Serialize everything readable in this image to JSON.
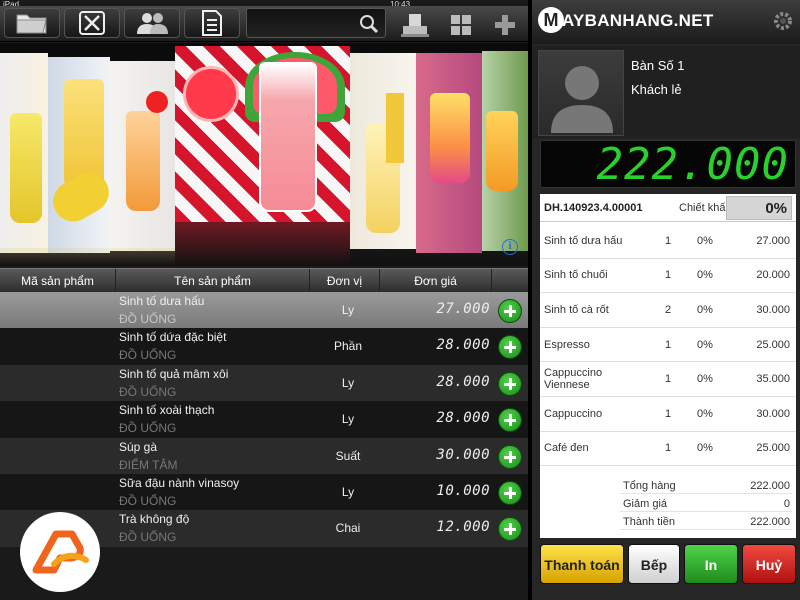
{
  "status": {
    "carrier": "iPad",
    "time": "10:43"
  },
  "toolbar": {
    "search_placeholder": "",
    "icons": [
      "folder-icon",
      "dining-icon",
      "users-icon",
      "document-icon",
      "search-icon",
      "printer-icon",
      "grid-icon",
      "plus-icon"
    ]
  },
  "table": {
    "headers": [
      "Mã sản phẩm",
      "Tên sản phẩm",
      "Đơn vị",
      "Đơn giá"
    ],
    "rows": [
      {
        "name": "Sinh tố dưa hấu",
        "category": "ĐỒ UỐNG",
        "unit": "Ly",
        "price": "27.000",
        "selected": true
      },
      {
        "name": "Sinh tố dứa đặc biệt",
        "category": "ĐỒ UỐNG",
        "unit": "Phần",
        "price": "28.000"
      },
      {
        "name": "Sinh tố quả mâm xôi",
        "category": "ĐỒ UỐNG",
        "unit": "Ly",
        "price": "28.000"
      },
      {
        "name": "Sinh tố xoài thạch",
        "category": "ĐỒ UỐNG",
        "unit": "Ly",
        "price": "28.000"
      },
      {
        "name": "Súp gà",
        "category": "ĐIỂM TÂM",
        "unit": "Suất",
        "price": "30.000"
      },
      {
        "name": "Sữa đậu nành vinasoy",
        "category": "ĐỒ UỐNG",
        "unit": "Ly",
        "price": "10.000"
      },
      {
        "name": "Trà không độ",
        "category": "ĐỒ UỐNG",
        "unit": "Chai",
        "price": "12.000"
      }
    ]
  },
  "brand": {
    "name": "AYBANHANG.NET",
    "initial": "M"
  },
  "customer": {
    "table": "Bàn Số 1",
    "name": "Khách lẻ"
  },
  "total_display": "222.000",
  "order": {
    "code": "DH.140923.4.00001",
    "discount_label": "Chiết khấu",
    "discount_value": "0%",
    "items": [
      {
        "name": "Sinh tố dưa hấu",
        "qty": "1",
        "disc": "0%",
        "price": "27.000"
      },
      {
        "name": "Sinh tố chuối",
        "qty": "1",
        "disc": "0%",
        "price": "20.000"
      },
      {
        "name": "Sinh tố cà rốt",
        "qty": "2",
        "disc": "0%",
        "price": "30.000"
      },
      {
        "name": "Espresso",
        "qty": "1",
        "disc": "0%",
        "price": "25.000"
      },
      {
        "name": "Cappuccino Viennese",
        "qty": "1",
        "disc": "0%",
        "price": "35.000"
      },
      {
        "name": "Cappuccino",
        "qty": "1",
        "disc": "0%",
        "price": "30.000"
      },
      {
        "name": "Café đen",
        "qty": "1",
        "disc": "0%",
        "price": "25.000"
      }
    ],
    "summary": [
      {
        "label": "Tổng hàng",
        "value": "222.000"
      },
      {
        "label": "Giảm giá",
        "value": "0"
      },
      {
        "label": "Thành tiền",
        "value": "222.000"
      }
    ]
  },
  "actions": {
    "pay": "Thanh toán",
    "kitchen": "Bếp",
    "print": "In",
    "cancel": "Huỷ"
  },
  "colors": {
    "total_led": "#29d12c",
    "pay": "#f2c417",
    "print": "#2fae2b",
    "cancel": "#d42a22"
  }
}
